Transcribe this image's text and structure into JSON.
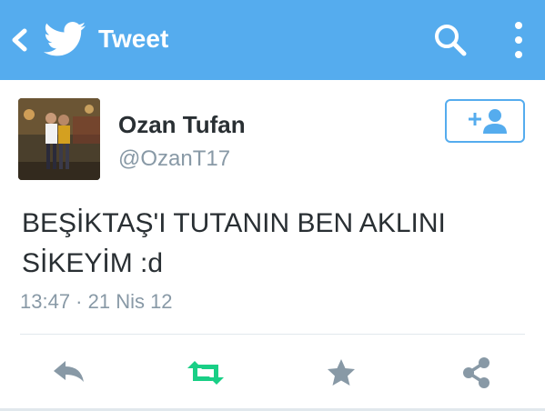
{
  "header": {
    "title": "Tweet",
    "back_icon": "chevron-left-icon",
    "logo_icon": "twitter-bird-icon",
    "search_icon": "search-icon",
    "more_icon": "more-vertical-icon",
    "color": "#55acee"
  },
  "tweet": {
    "author_name": "Ozan Tufan",
    "author_handle": "@OzanT17",
    "text_lines": [
      "BEŞİKTAŞ'I TUTANIN BEN AKLINI",
      "SİKEYİM :d"
    ],
    "timestamp": "13:47 · 21 Nis 12",
    "follow_icon": "add-user-icon"
  },
  "actions": [
    {
      "name": "reply",
      "icon": "reply-icon",
      "color": "#8899a6"
    },
    {
      "name": "retweet",
      "icon": "retweet-icon",
      "color": "#19cf86"
    },
    {
      "name": "favorite",
      "icon": "star-icon",
      "color": "#8899a6"
    },
    {
      "name": "share",
      "icon": "share-icon",
      "color": "#8899a6"
    }
  ]
}
